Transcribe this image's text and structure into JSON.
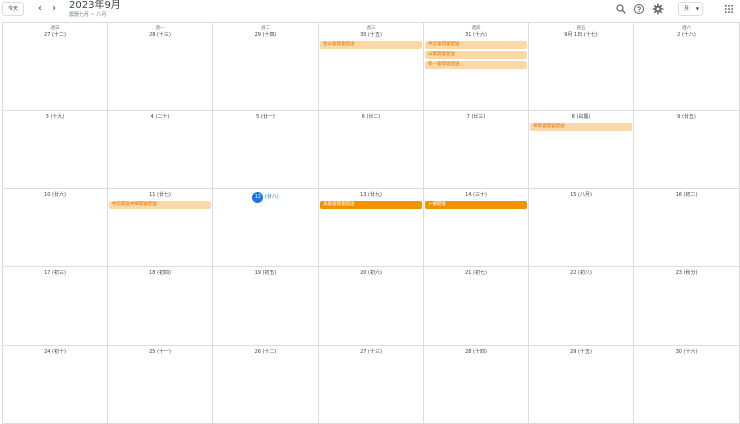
{
  "header": {
    "today_label": "今天",
    "prev_icon": "chevron-left-icon",
    "next_icon": "chevron-right-icon",
    "title": "2023年9月",
    "subtitle": "農曆七月 ~ 八月",
    "search_icon": "search-icon",
    "help_icon": "help-icon",
    "settings_icon": "gear-icon",
    "view_label": "月",
    "apps_icon": "apps-grid-icon"
  },
  "weekdays": [
    "週日",
    "週一",
    "週二",
    "週三",
    "週四",
    "週五",
    "週六"
  ],
  "weeks": [
    {
      "days": [
        {
          "num": "27",
          "lunar": "(十二)",
          "events": []
        },
        {
          "num": "28",
          "lunar": "(十三)",
          "events": []
        },
        {
          "num": "29",
          "lunar": "(十四)",
          "events": []
        },
        {
          "num": "30",
          "lunar": "(十五)",
          "events": [
            {
              "label": "金山會開會配送",
              "style": "light"
            }
          ]
        },
        {
          "num": "31",
          "lunar": "(十六)",
          "events": [
            {
              "label": "中信會開會配送",
              "style": "light"
            },
            {
              "label": "山葉開會配送",
              "style": "light"
            },
            {
              "label": "新一會開會配送",
              "style": "light"
            }
          ]
        },
        {
          "num": "9月 1日",
          "lunar": "(十七)",
          "events": []
        },
        {
          "num": "2",
          "lunar": "(十八)",
          "events": []
        }
      ]
    },
    {
      "days": [
        {
          "num": "3",
          "lunar": "(十九)",
          "events": []
        },
        {
          "num": "4",
          "lunar": "(二十)",
          "events": []
        },
        {
          "num": "5",
          "lunar": "(廿一)",
          "events": []
        },
        {
          "num": "6",
          "lunar": "(廿二)",
          "events": []
        },
        {
          "num": "7",
          "lunar": "(廿三)",
          "events": []
        },
        {
          "num": "8",
          "lunar": "(白露)",
          "events": [
            {
              "label": "華南會開會配送",
              "style": "light"
            }
          ]
        },
        {
          "num": "9",
          "lunar": "(廿五)",
          "events": []
        }
      ]
    },
    {
      "days": [
        {
          "num": "10",
          "lunar": "(廿六)",
          "events": []
        },
        {
          "num": "11",
          "lunar": "(廿七)",
          "events": [
            {
              "label": "中信開區中華開會配送",
              "style": "light"
            }
          ]
        },
        {
          "num": "12",
          "lunar": "(廿八)",
          "events": [],
          "today": true
        },
        {
          "num": "13",
          "lunar": "(廿九)",
          "events": [
            {
              "label": "高雄會開會配送",
              "style": "dark"
            }
          ]
        },
        {
          "num": "14",
          "lunar": "(三十)",
          "events": [
            {
              "label": "卜蜂開會",
              "style": "dark"
            }
          ]
        },
        {
          "num": "15",
          "lunar": "(八月)",
          "events": []
        },
        {
          "num": "16",
          "lunar": "(初二)",
          "events": []
        }
      ]
    },
    {
      "days": [
        {
          "num": "17",
          "lunar": "(初三)",
          "events": []
        },
        {
          "num": "18",
          "lunar": "(初四)",
          "events": []
        },
        {
          "num": "19",
          "lunar": "(初五)",
          "events": []
        },
        {
          "num": "20",
          "lunar": "(初六)",
          "events": []
        },
        {
          "num": "21",
          "lunar": "(初七)",
          "events": []
        },
        {
          "num": "22",
          "lunar": "(初八)",
          "events": []
        },
        {
          "num": "23",
          "lunar": "(秋分)",
          "events": []
        }
      ]
    },
    {
      "days": [
        {
          "num": "24",
          "lunar": "(初十)",
          "events": []
        },
        {
          "num": "25",
          "lunar": "(十一)",
          "events": []
        },
        {
          "num": "26",
          "lunar": "(十二)",
          "events": []
        },
        {
          "num": "27",
          "lunar": "(十三)",
          "events": []
        },
        {
          "num": "28",
          "lunar": "(十四)",
          "events": []
        },
        {
          "num": "29",
          "lunar": "(十五)",
          "events": []
        },
        {
          "num": "30",
          "lunar": "(十六)",
          "events": []
        }
      ]
    }
  ],
  "colors": {
    "accent": "#1a73e8",
    "event_light": "#fbd9a6",
    "event_dark": "#f09300",
    "grid": "#dadce0"
  }
}
